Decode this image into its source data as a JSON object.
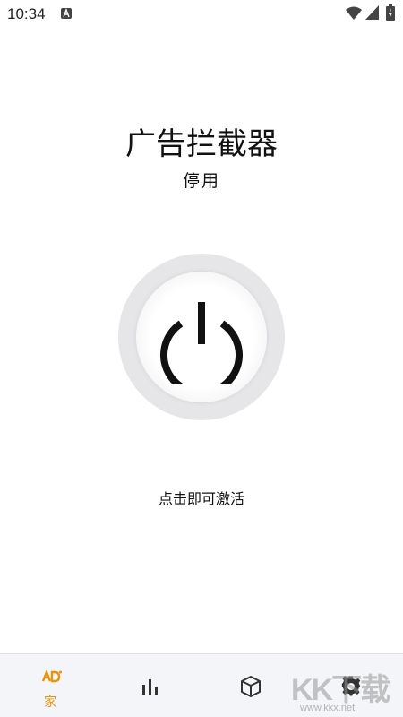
{
  "status_bar": {
    "time": "10:34",
    "notification_icon": "a-icon",
    "icons": [
      "wifi-icon",
      "signal-icon",
      "battery-icon"
    ]
  },
  "main": {
    "title": "广告拦截器",
    "status": "停用",
    "power_icon": "power-icon",
    "hint": "点击即可激活"
  },
  "bottom_nav": {
    "items": [
      {
        "icon": "ad-icon",
        "label": "家",
        "active": true
      },
      {
        "icon": "bar-chart-icon",
        "label": ""
      },
      {
        "icon": "package-icon",
        "label": ""
      },
      {
        "icon": "gear-icon",
        "label": ""
      }
    ]
  },
  "watermark": {
    "text": "KK下载",
    "url": "www.kkx.net"
  },
  "colors": {
    "accent": "#e8930c",
    "power_ring": "#e6e6e9",
    "nav_background": "#f4f5f8"
  }
}
